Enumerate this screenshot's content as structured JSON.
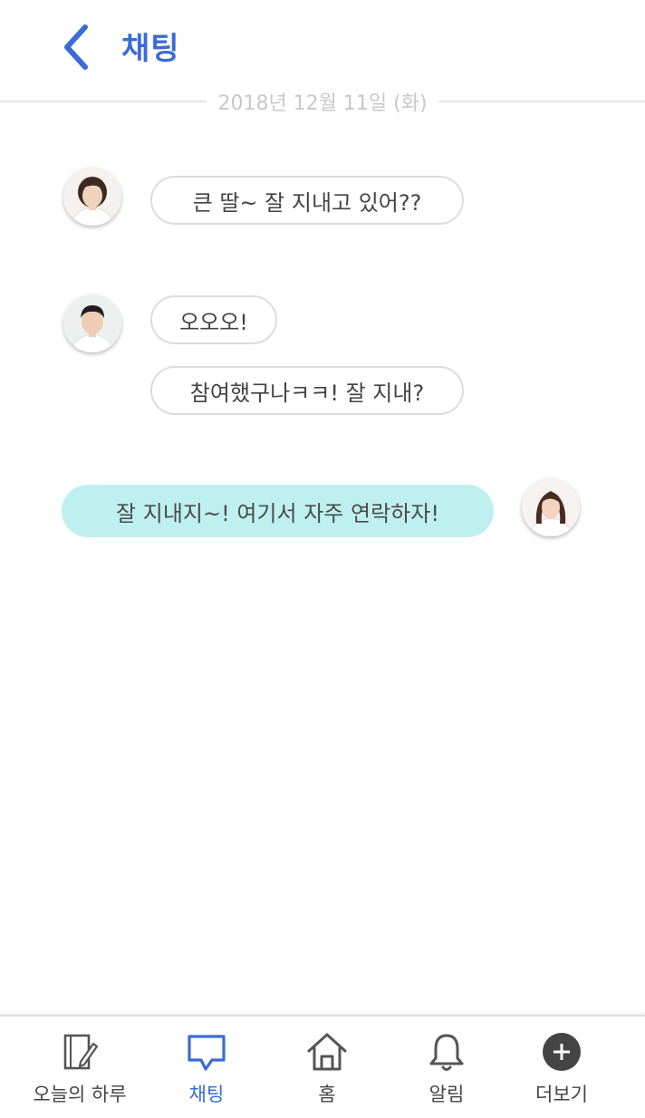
{
  "header": {
    "title": "채팅"
  },
  "date_divider": "2018년 12월 11일 (화)",
  "messages": [
    {
      "text": "큰 딸~ 잘 지내고 있어??",
      "sender": "other",
      "avatar": "woman-older-avatar"
    },
    {
      "text": "오오오!",
      "sender": "other",
      "avatar": "man-avatar"
    },
    {
      "text": "참여했구나ㅋㅋ! 잘 지내?",
      "sender": "other",
      "avatar": "man-avatar"
    },
    {
      "text": "잘 지내지~! 여기서 자주 연락하자!",
      "sender": "me",
      "avatar": "woman-young-avatar"
    }
  ],
  "bottom_nav": {
    "items": [
      {
        "label": "오늘의 하루",
        "icon": "notebook-pencil-icon",
        "active": false
      },
      {
        "label": "채팅",
        "icon": "chat-bubble-icon",
        "active": true
      },
      {
        "label": "홈",
        "icon": "home-icon",
        "active": false
      },
      {
        "label": "알림",
        "icon": "bell-icon",
        "active": false
      },
      {
        "label": "더보기",
        "icon": "plus-circle-icon",
        "active": false
      }
    ]
  },
  "colors": {
    "accent": "#3b6bd8",
    "my_bubble": "#bff0f0",
    "bubble_border": "#dcdcdc",
    "date_text": "#c8c8c8"
  }
}
